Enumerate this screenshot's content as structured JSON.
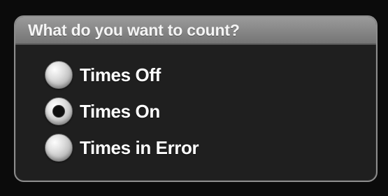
{
  "panel": {
    "title": "What do you want to count?"
  },
  "options": [
    {
      "label": "Times Off",
      "selected": false
    },
    {
      "label": "Times On",
      "selected": true
    },
    {
      "label": "Times in Error",
      "selected": false
    }
  ],
  "colors": {
    "background": "#0b0b0b",
    "panel_background": "#1f1f1f",
    "header_gradient_top": "#9b9b9b",
    "header_gradient_bottom": "#747474",
    "text": "#ffffff"
  }
}
